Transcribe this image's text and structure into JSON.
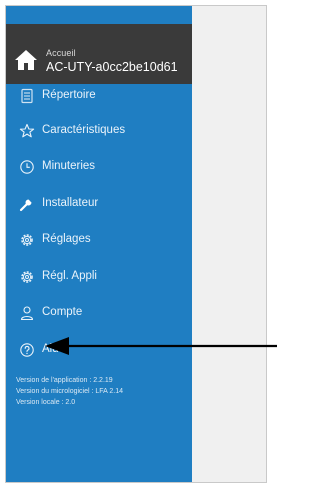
{
  "header": {
    "title": "Accueil",
    "device": "AC-UTY-a0cc2be10d61",
    "icon": "home-icon"
  },
  "menu": {
    "items": [
      {
        "label": "Répertoire",
        "icon": "list-icon"
      },
      {
        "label": "Caractéristiques",
        "icon": "star-icon"
      },
      {
        "label": "Minuteries",
        "icon": "clock-icon"
      },
      {
        "label": "Installateur",
        "icon": "wrench-icon"
      },
      {
        "label": "Réglages",
        "icon": "gear-icon"
      },
      {
        "label": "Régl. Appli",
        "icon": "gear-icon"
      },
      {
        "label": "Compte",
        "icon": "person-icon"
      },
      {
        "label": "Aide",
        "icon": "help-icon"
      }
    ]
  },
  "versions": {
    "app": "Version de l'application : 2.2.19",
    "firmware": "Version du micrologiciel : LFA 2.14",
    "local": "Version locale : 2.0"
  },
  "colors": {
    "panel": "#1f7ec2",
    "header": "#3a3a3a",
    "content_bg": "#f0f0f0"
  }
}
